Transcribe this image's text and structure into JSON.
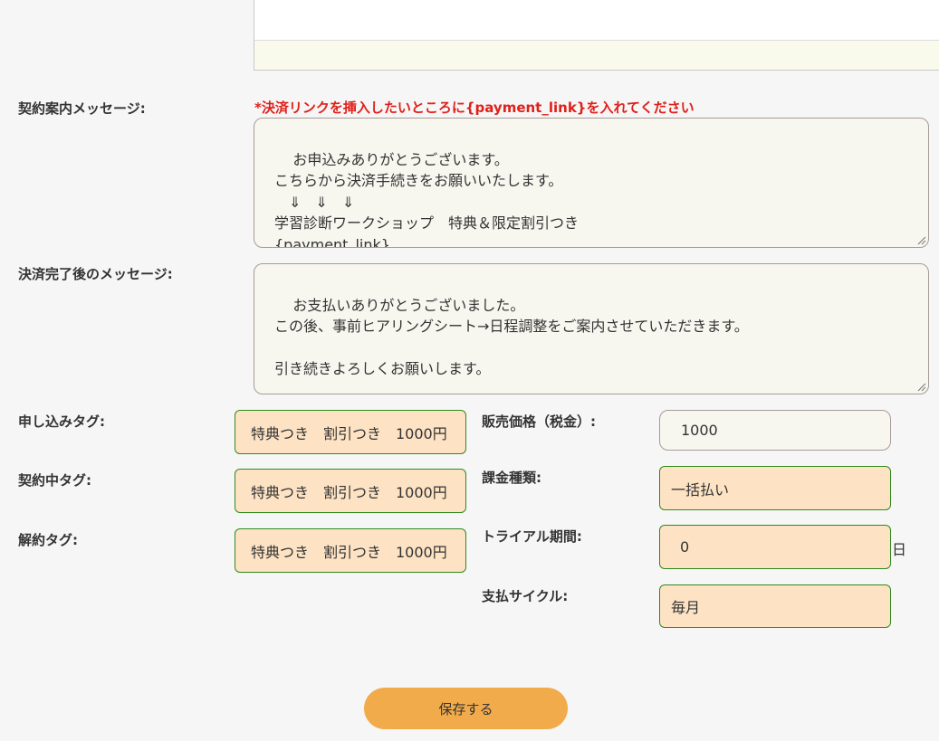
{
  "notice": "*決済リンクを挿入したいところに{payment_link}を入れてください",
  "contract_message": {
    "label": "契約案内メッセージ:",
    "value": "お申込みありがとうございます。\nこちらから決済手続きをお願いいたします。\n　⇓　⇓　⇓\n学習診断ワークショップ　特典＆限定割引つき\n{payment_link}"
  },
  "completion_message": {
    "label": "決済完了後のメッセージ:",
    "value": "お支払いありがとうございました。\nこの後、事前ヒアリングシート→日程調整をご案内させていただきます。\n\n引き続きよろしくお願いします。"
  },
  "tags": {
    "apply": {
      "label": "申し込みタグ:",
      "value": "特典つき　割引つき　1000円"
    },
    "active": {
      "label": "契約中タグ:",
      "value": "特典つき　割引つき　1000円"
    },
    "cancel": {
      "label": "解約タグ:",
      "value": "特典つき　割引つき　1000円"
    }
  },
  "pricing": {
    "price": {
      "label": "販売価格（税金）:",
      "value": "1000"
    },
    "billing_type": {
      "label": "課金種類:",
      "value": "一括払い"
    },
    "trial_period": {
      "label": "トライアル期間:",
      "value": "0",
      "unit": "日"
    },
    "payment_cycle": {
      "label": "支払サイクル:",
      "value": "毎月"
    }
  },
  "save_button": "保存する"
}
